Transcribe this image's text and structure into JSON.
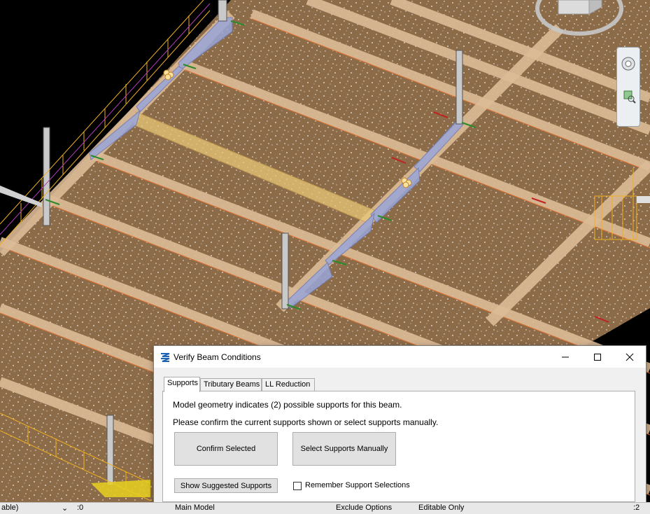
{
  "dialog": {
    "title": "Verify Beam Conditions",
    "tabs": [
      "Supports",
      "Tributary Beams",
      "LL Reduction"
    ],
    "active_tab": "Supports",
    "message_line1": "Model geometry indicates (2) possible supports for this beam.",
    "message_line2": "Please confirm the current supports shown or select supports manually.",
    "confirm_selected_label": "Confirm Selected",
    "select_manually_label": "Select Supports Manually",
    "show_suggested_label": "Show Suggested Supports",
    "remember_label": "Remember Support Selections",
    "remember_checked": false
  },
  "statusbar": {
    "view_selector": "able)",
    "selection_count": ":0",
    "model_selector": "Main Model",
    "exclude_options": "Exclude Options",
    "editable_only": "Editable Only",
    "filter_count": ":2"
  },
  "colors": {
    "floor": "#8c6b48",
    "beam": "#dcbb97",
    "highlight_beam": "#e8c878",
    "support_blue": "#9aa6d8",
    "background": "#000000",
    "arrow": "#e8272f"
  },
  "icons": [
    "app-logo-icon",
    "minimize-icon",
    "maximize-icon",
    "close-icon",
    "nav-wheel-icon",
    "zoom-region-icon",
    "view-cube-icon",
    "arrow-annotation-icon",
    "checkbox-icon"
  ]
}
